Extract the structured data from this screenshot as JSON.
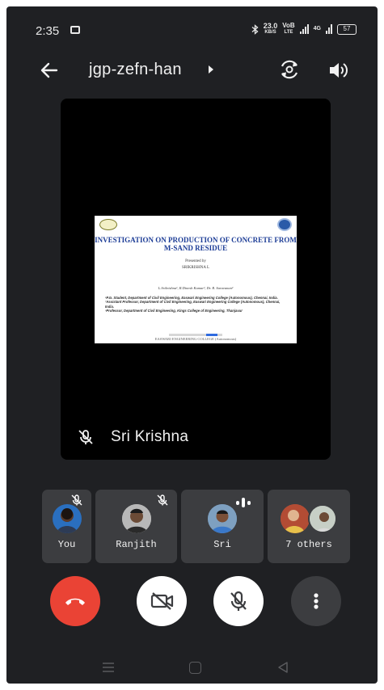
{
  "status_bar": {
    "time": "2:35",
    "net_speed_value": "23.0",
    "net_speed_unit": "KB/S",
    "volte_top": "VoB",
    "volte_bottom": "LTE",
    "network_type": "4G",
    "battery": "57"
  },
  "header": {
    "meeting_code": "jgp-zefn-han"
  },
  "main_tile": {
    "participant_name": "Sri Krishna",
    "slide": {
      "title": "INVESTIGATION ON PRODUCTION OF CONCRETE FROM M-SAND RESIDUE",
      "presented_by": "Presented by",
      "presenter": "SRIKRISHNA L",
      "authors": "L.Srikrishna¹, R.Dinesh Kumar², Dr. R. Saravanan³",
      "affiliations": [
        "¹P.G. Student, Department of Civil Engineering, Easwari Engineering College (Autonomous), Chennai, India.",
        "²Assistant Professor, Department of Civil Engineering, Easwari Engineering College (Autonomous), Chennai, India.",
        "³Professor, Department of Civil Engineering, Kings College of Engineering, Thanjavur"
      ],
      "footer": "EASWARI ENGINEERING COLLEGE (Autonomous)"
    }
  },
  "participants": [
    {
      "name": "You",
      "muted": true
    },
    {
      "name": "Ranjith",
      "muted": true
    },
    {
      "name": "Sri",
      "speaking": true
    },
    {
      "name": "7 others"
    }
  ],
  "colors": {
    "background": "#1f2023",
    "tile": "#3c3d40",
    "end_call": "#ea4335",
    "slide_title": "#1c3c96"
  }
}
